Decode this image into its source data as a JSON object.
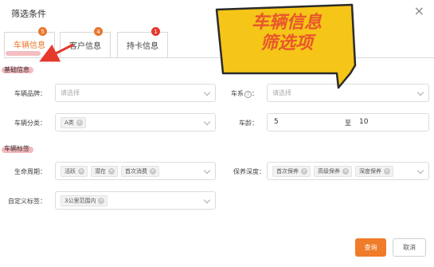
{
  "dialog": {
    "title": "筛选条件",
    "close_icon": "close-icon"
  },
  "tabs": [
    {
      "label": "车辆信息",
      "badge": "5",
      "active": true
    },
    {
      "label": "客户信息",
      "badge": "4",
      "active": false
    },
    {
      "label": "持卡信息",
      "badge": "1",
      "active": false
    }
  ],
  "sections": {
    "basic": "基础信息",
    "tags": "车辆标签"
  },
  "fields": {
    "brand": {
      "label": "车辆品牌：",
      "placeholder": "请选择"
    },
    "series": {
      "label": "车系",
      "help_icon": "question-circle-icon",
      "placeholder": "请选择"
    },
    "category": {
      "label": "车辆分类：",
      "tags": [
        "A类"
      ]
    },
    "age": {
      "label": "车龄：",
      "from": "5",
      "sep": "至",
      "to": "10"
    },
    "lifecycle": {
      "label": "生命周期：",
      "tags": [
        "活跃",
        "潜在",
        "首次消费"
      ]
    },
    "maintenance": {
      "label": "保养深度：",
      "tags": [
        "首次保养",
        "高级保养",
        "深度保养"
      ]
    },
    "custom": {
      "label": "自定义标签：",
      "tags": [
        "3公里范围内"
      ]
    }
  },
  "buttons": {
    "query": "查询",
    "cancel": "取消"
  },
  "annotation": {
    "line1": "车辆信息",
    "line2": "筛选项",
    "fill": "#f5c518",
    "stroke": "#2b2b2b",
    "text_color": "#e8572c",
    "arrow_color": "#e5392c"
  },
  "colors": {
    "accent": "#f07c2a",
    "badge_red": "#e5392c",
    "highlight": "#f2a8ae"
  }
}
